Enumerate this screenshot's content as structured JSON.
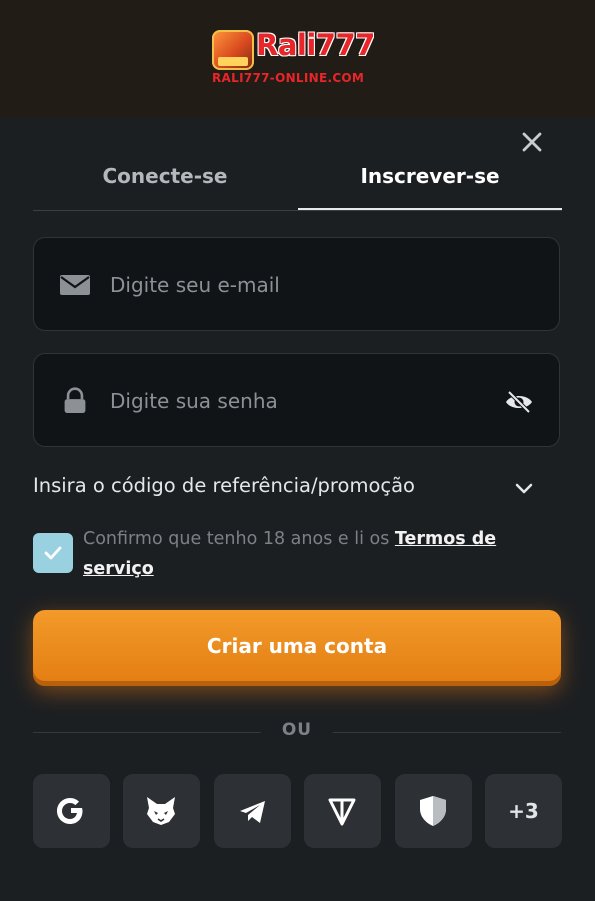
{
  "brand": {
    "name": "Rali777",
    "domain": "RALI777-ONLINE.COM"
  },
  "auth_modal": {
    "close_icon": "close-icon",
    "tabs": [
      {
        "label": "Conecte-se",
        "active": false
      },
      {
        "label": "Inscrever-se",
        "active": true
      }
    ],
    "email": {
      "placeholder": "Digite seu e-mail",
      "value": "",
      "icon": "envelope-icon"
    },
    "password": {
      "placeholder": "Digite sua senha",
      "value": "",
      "icon": "lock-icon",
      "toggle_icon": "eye-off-icon"
    },
    "promo": {
      "label": "Insira o código de referência/promoção",
      "icon": "chevron-down-icon"
    },
    "terms": {
      "checked": true,
      "text": "Confirmo que tenho 18 anos e li os ",
      "link": "Termos de serviço"
    },
    "submit_label": "Criar uma conta",
    "or_label": "OU",
    "socials": [
      {
        "name": "google",
        "icon": "google-icon"
      },
      {
        "name": "metamask",
        "icon": "fox-icon"
      },
      {
        "name": "telegram",
        "icon": "telegram-icon"
      },
      {
        "name": "ton",
        "icon": "ton-icon"
      },
      {
        "name": "shield",
        "icon": "shield-icon"
      },
      {
        "name": "more",
        "label": "+3"
      }
    ]
  },
  "colors": {
    "background": "#1c1f22",
    "header": "#221c16",
    "accent": "#ef8c1e",
    "checkbox": "#9ad1e0",
    "brand_red": "#e8262a"
  }
}
